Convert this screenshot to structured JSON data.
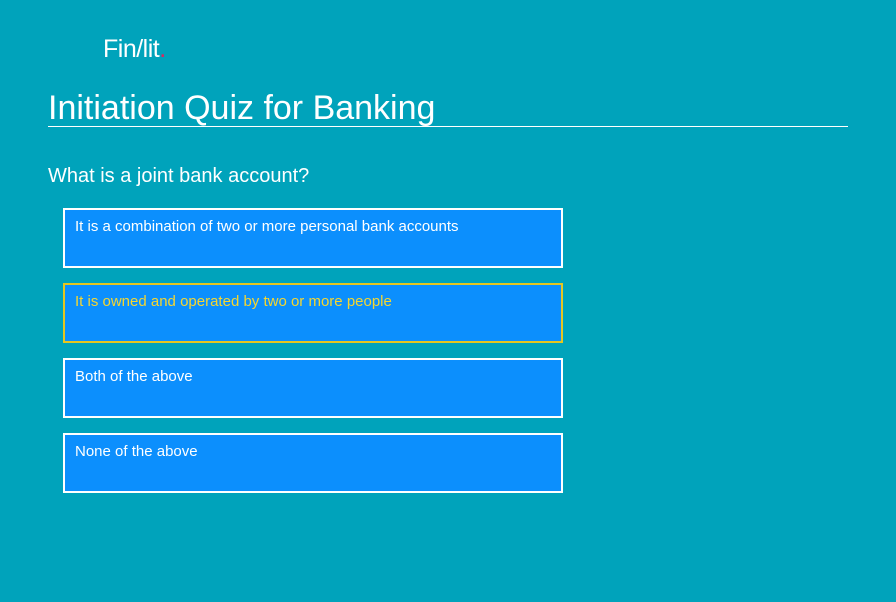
{
  "app": {
    "logo_text": "Fin/lit",
    "logo_dot": "."
  },
  "quiz": {
    "title": "Initiation Quiz for Banking",
    "question": "What is a joint bank account?",
    "options": [
      {
        "label": "It is a combination of two or more personal bank accounts",
        "selected": false
      },
      {
        "label": "It is owned and operated by two or more people",
        "selected": true
      },
      {
        "label": "Both of the above",
        "selected": false
      },
      {
        "label": "None of the above",
        "selected": false
      }
    ]
  },
  "colors": {
    "background": "#00a3bb",
    "option_fill": "#0c8ffd",
    "option_border": "#ffffff",
    "selected_border": "#e5c61f",
    "selected_text": "#f5d630",
    "logo_dot": "#e0245e"
  }
}
